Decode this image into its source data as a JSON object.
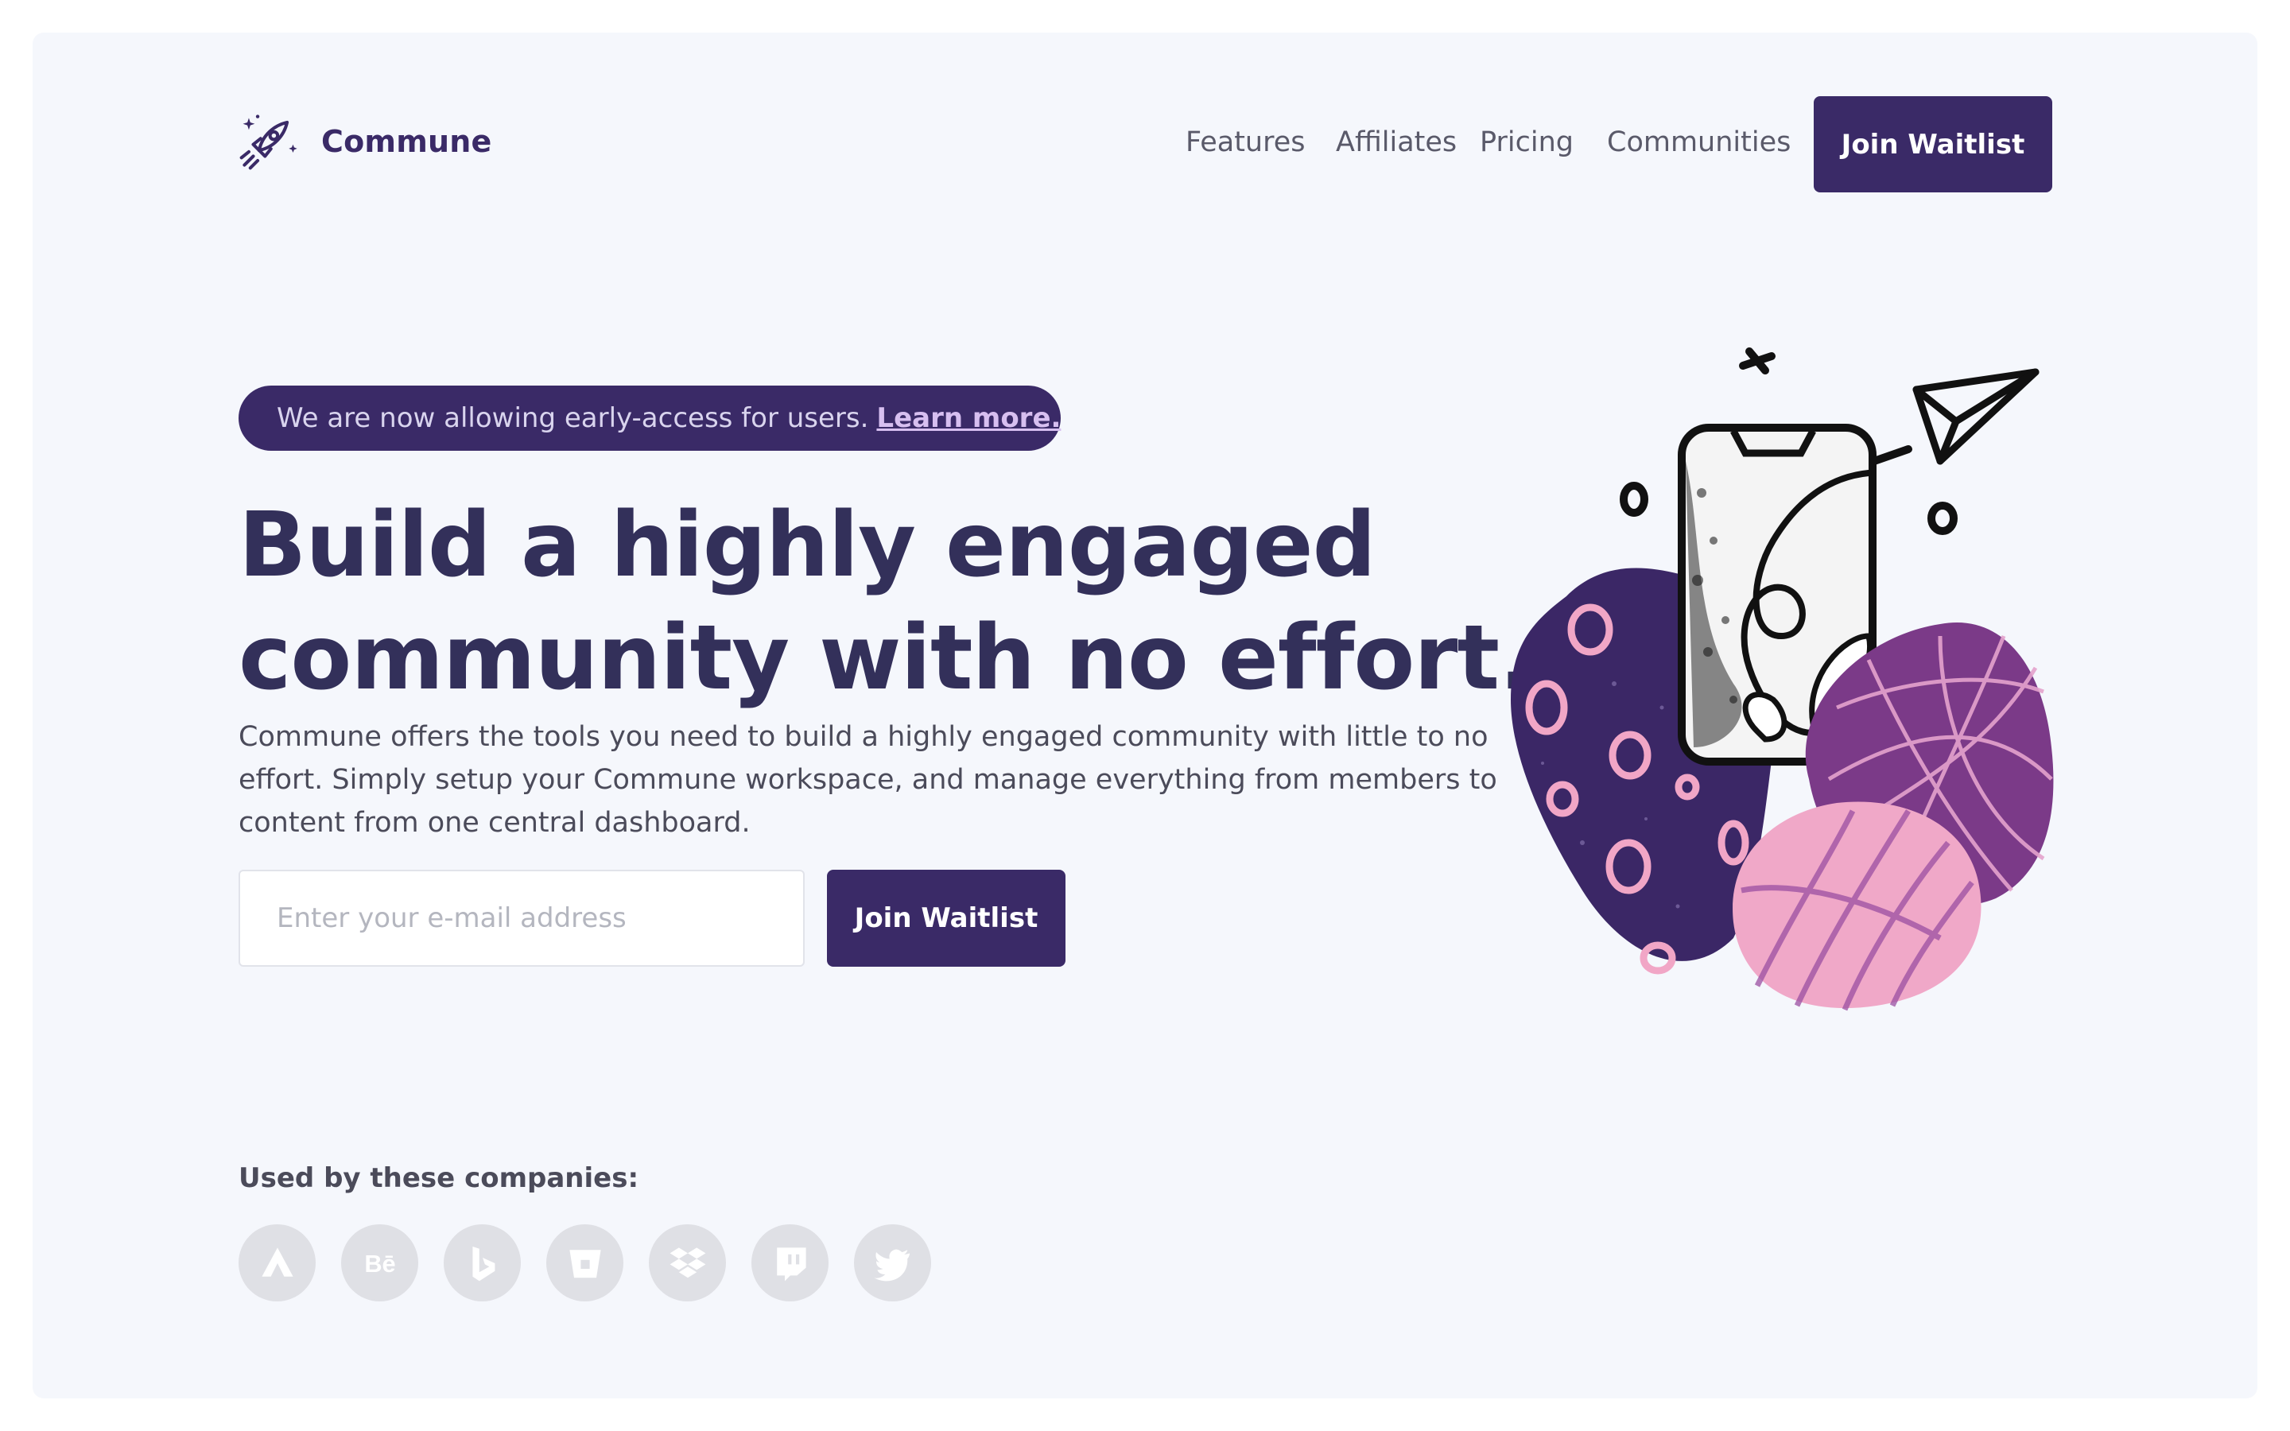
{
  "brand": {
    "name": "Commune",
    "accent": "#3a2a67",
    "pink": "#efa7c7",
    "purple": "#7b3a88"
  },
  "nav": {
    "links": [
      "Features",
      "Affiliates",
      "Pricing",
      "Communities"
    ],
    "cta_label": "Join Waitlist"
  },
  "hero": {
    "banner_text": "We are now allowing early-access for users.",
    "banner_link": "Learn more.",
    "headline_line1": "Build a highly engaged",
    "headline_line2": "community with no effort.",
    "description_line1": "Commune offers the tools you need to build a highly engaged community with little to no",
    "description_line2": "effort. Simply setup your Commune workspace, and manage everything from members to",
    "description_line3": "content from one central dashboard.",
    "email_placeholder": "Enter your e-mail address",
    "cta_label": "Join Waitlist"
  },
  "companies": {
    "heading": "Used by these companies:",
    "logos": [
      "atlassian-icon",
      "behance-icon",
      "bing-icon",
      "bitbucket-icon",
      "dropbox-icon",
      "twitch-icon",
      "twitter-icon"
    ]
  }
}
